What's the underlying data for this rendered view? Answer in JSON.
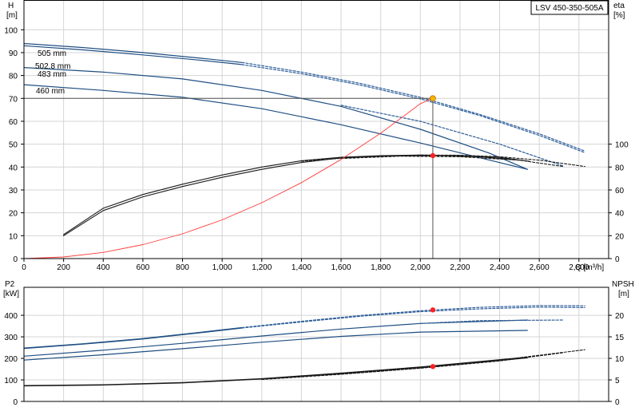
{
  "model_label": "LSV 450-350-505A",
  "colors": {
    "head": "#1f4e82",
    "head_dashed": "#2f5f99",
    "efficiency": "#1a1a1a",
    "system": "#ff3b3b",
    "op_point_top": "#f5b400",
    "op_point": "#ff2020",
    "op_line": "#555555",
    "grid": "#d4d4d4"
  },
  "chart_data": [
    {
      "id": "top",
      "type": "line",
      "title": "",
      "xlabel": "Q [m³/h]",
      "ylabel_left": "H\n[m]",
      "ylabel_right": "eta\n[%]",
      "xlim": [
        0,
        2950
      ],
      "ylim_left": [
        0,
        113
      ],
      "ylim_right": [
        0,
        226
      ],
      "x_ticks": [
        "0",
        "200",
        "400",
        "600",
        "800",
        "1,000",
        "1,200",
        "1,400",
        "1,600",
        "1,800",
        "2,000",
        "2,200",
        "2,400",
        "2,600",
        "2,800"
      ],
      "x_tick_values": [
        0,
        200,
        400,
        600,
        800,
        1000,
        1200,
        1400,
        1600,
        1800,
        2000,
        2200,
        2400,
        2600,
        2800
      ],
      "y_ticks_left": [
        0,
        10,
        20,
        30,
        40,
        50,
        60,
        70,
        80,
        90,
        100
      ],
      "y_ticks_right": [
        0,
        20,
        40,
        60,
        80,
        100
      ],
      "annotations": [
        "505 mm",
        "502.8 mm",
        "483 mm",
        "460 mm"
      ],
      "series": [
        {
          "label": "505 mm",
          "axis": "left",
          "role": "head",
          "style": "solid",
          "x": [
            0,
            300,
            600,
            900,
            1100
          ],
          "y": [
            94,
            92.2,
            90,
            87.5,
            85.7
          ]
        },
        {
          "label": "505 mm",
          "axis": "left",
          "role": "head",
          "style": "dashed",
          "x": [
            1100,
            1400,
            1700,
            2000,
            2300,
            2600,
            2830
          ],
          "y": [
            85.7,
            81.5,
            76.5,
            70.5,
            63,
            54.5,
            47
          ]
        },
        {
          "label": "502.8 mm",
          "axis": "left",
          "role": "head",
          "style": "solid",
          "x": [
            0,
            300,
            600,
            900,
            1100
          ],
          "y": [
            93,
            91.2,
            89,
            86.6,
            84.8
          ]
        },
        {
          "label": "502.8 mm",
          "axis": "left",
          "role": "head",
          "style": "dashed",
          "x": [
            1100,
            1400,
            1700,
            2000,
            2300,
            2600,
            2830
          ],
          "y": [
            84.8,
            80.8,
            75.8,
            69.8,
            62.5,
            53.8,
            46.3
          ]
        },
        {
          "label": "483 mm",
          "axis": "left",
          "role": "head",
          "style": "solid",
          "x": [
            0,
            400,
            800,
            1200,
            1600,
            2000,
            2350,
            2540
          ],
          "y": [
            83.5,
            81.5,
            78.5,
            73.5,
            66.5,
            56.5,
            46,
            39
          ]
        },
        {
          "label": "483 mm",
          "axis": "left",
          "role": "head",
          "style": "dashed",
          "x": [
            1600,
            2000,
            2400,
            2720
          ],
          "y": [
            67,
            60,
            50,
            40.5
          ]
        },
        {
          "label": "460 mm",
          "axis": "left",
          "role": "head",
          "style": "solid",
          "x": [
            0,
            400,
            800,
            1200,
            1600,
            2000,
            2350,
            2540
          ],
          "y": [
            76,
            73.5,
            70.5,
            65.5,
            58.5,
            50.5,
            43,
            39
          ]
        },
        {
          "label": "",
          "axis": "right",
          "role": "efficiency",
          "style": "solid",
          "x": [
            200,
            400,
            600,
            800,
            1000,
            1200,
            1400,
            1600,
            1800,
            2000,
            2100,
            2300,
            2500
          ],
          "y": [
            20,
            42,
            54,
            63,
            71,
            78,
            84,
            88,
            89.5,
            90,
            90,
            89,
            86
          ]
        },
        {
          "label": "",
          "axis": "right",
          "role": "efficiency",
          "style": "solid",
          "x": [
            200,
            400,
            600,
            800,
            1000,
            1200,
            1400,
            1600,
            1800,
            2000,
            2200,
            2400,
            2550
          ],
          "y": [
            21,
            44,
            56,
            65,
            73,
            80,
            85.5,
            88.5,
            90,
            90.5,
            90,
            88.5,
            85
          ]
        },
        {
          "label": "",
          "axis": "right",
          "role": "efficiency",
          "style": "dashed",
          "x": [
            1400,
            1700,
            2000,
            2200,
            2400,
            2600,
            2830
          ],
          "y": [
            85,
            89,
            90.5,
            90.3,
            89,
            86,
            80.5
          ]
        },
        {
          "label": "",
          "axis": "right",
          "role": "efficiency",
          "style": "dashed",
          "x": [
            1600,
            1900,
            2200,
            2500,
            2720
          ],
          "y": [
            87.5,
            89.5,
            89,
            86,
            80.5
          ]
        },
        {
          "label": "",
          "axis": "left",
          "role": "system",
          "style": "solid",
          "x": [
            0,
            200,
            400,
            600,
            800,
            1000,
            1200,
            1400,
            1600,
            1800,
            2000,
            2063
          ],
          "y": [
            0,
            0.7,
            2.7,
            6.1,
            10.8,
            16.9,
            24.4,
            33.2,
            43.3,
            54.8,
            67.7,
            70
          ]
        }
      ],
      "operating_point": {
        "x": 2063,
        "head": 70,
        "eta": 90
      }
    },
    {
      "id": "bottom",
      "type": "line",
      "title": "",
      "xlabel": "",
      "ylabel_left": "P2\n[kW]",
      "ylabel_right": "NPSH\n[m]",
      "xlim": [
        0,
        2950
      ],
      "ylim_left": [
        0,
        530
      ],
      "ylim_right": [
        0,
        26.5
      ],
      "y_ticks_left": [
        0,
        100,
        200,
        300,
        400
      ],
      "y_ticks_right": [
        0,
        5,
        10,
        15,
        20
      ],
      "series": [
        {
          "label": "",
          "axis": "left",
          "role": "power",
          "style": "solid",
          "x": [
            0,
            300,
            600,
            900,
            1100
          ],
          "y": [
            248,
            268,
            292,
            322,
            343
          ]
        },
        {
          "label": "",
          "axis": "left",
          "role": "power",
          "style": "dashed",
          "x": [
            1100,
            1400,
            1700,
            2000,
            2300,
            2600,
            2830
          ],
          "y": [
            343,
            372,
            399,
            421,
            437,
            445,
            444
          ]
        },
        {
          "label": "",
          "axis": "left",
          "role": "power",
          "style": "solid",
          "x": [
            0,
            300,
            600,
            900,
            1100
          ],
          "y": [
            246,
            266,
            290,
            320,
            341
          ]
        },
        {
          "label": "",
          "axis": "left",
          "role": "power",
          "style": "dashed",
          "x": [
            1100,
            1400,
            1700,
            2000,
            2300,
            2600,
            2830
          ],
          "y": [
            341,
            369,
            396,
            417,
            430,
            438,
            436
          ]
        },
        {
          "label": "",
          "axis": "left",
          "role": "power",
          "style": "solid",
          "x": [
            0,
            400,
            800,
            1200,
            1600,
            2000,
            2540
          ],
          "y": [
            210,
            238,
            270,
            304,
            336,
            362,
            378
          ]
        },
        {
          "label": "",
          "axis": "left",
          "role": "power",
          "style": "dashed",
          "x": [
            2000,
            2300,
            2720
          ],
          "y": [
            362,
            375,
            378
          ]
        },
        {
          "label": "",
          "axis": "left",
          "role": "power",
          "style": "solid",
          "x": [
            0,
            400,
            800,
            1200,
            1600,
            2000,
            2540
          ],
          "y": [
            192,
            217,
            245,
            275,
            302,
            322,
            330
          ]
        },
        {
          "label": "",
          "axis": "right",
          "role": "npsh",
          "style": "solid",
          "x": [
            0,
            400,
            800,
            1200,
            1600,
            2000,
            2400,
            2540
          ],
          "y": [
            3.7,
            3.9,
            4.4,
            5.3,
            6.6,
            8.0,
            9.7,
            10.3
          ]
        },
        {
          "label": "",
          "axis": "right",
          "role": "npsh",
          "style": "dashed",
          "x": [
            1200,
            1600,
            2000,
            2400,
            2830
          ],
          "y": [
            5.2,
            6.5,
            7.9,
            9.6,
            12.0
          ]
        },
        {
          "label": "",
          "axis": "right",
          "role": "npsh",
          "style": "solid",
          "x": [
            0,
            400,
            800,
            1200,
            1600,
            2000,
            2400,
            2540
          ],
          "y": [
            3.6,
            3.8,
            4.3,
            5.2,
            6.4,
            7.8,
            9.5,
            10.1
          ]
        },
        {
          "label": "",
          "axis": "right",
          "role": "npsh",
          "style": "dashed",
          "x": [
            1200,
            1600,
            2000,
            2400,
            2720
          ],
          "y": [
            5.1,
            6.3,
            7.7,
            9.4,
            11.3
          ]
        }
      ],
      "operating_point": {
        "x": 2063,
        "power": 425,
        "npsh": 8.1
      }
    }
  ]
}
